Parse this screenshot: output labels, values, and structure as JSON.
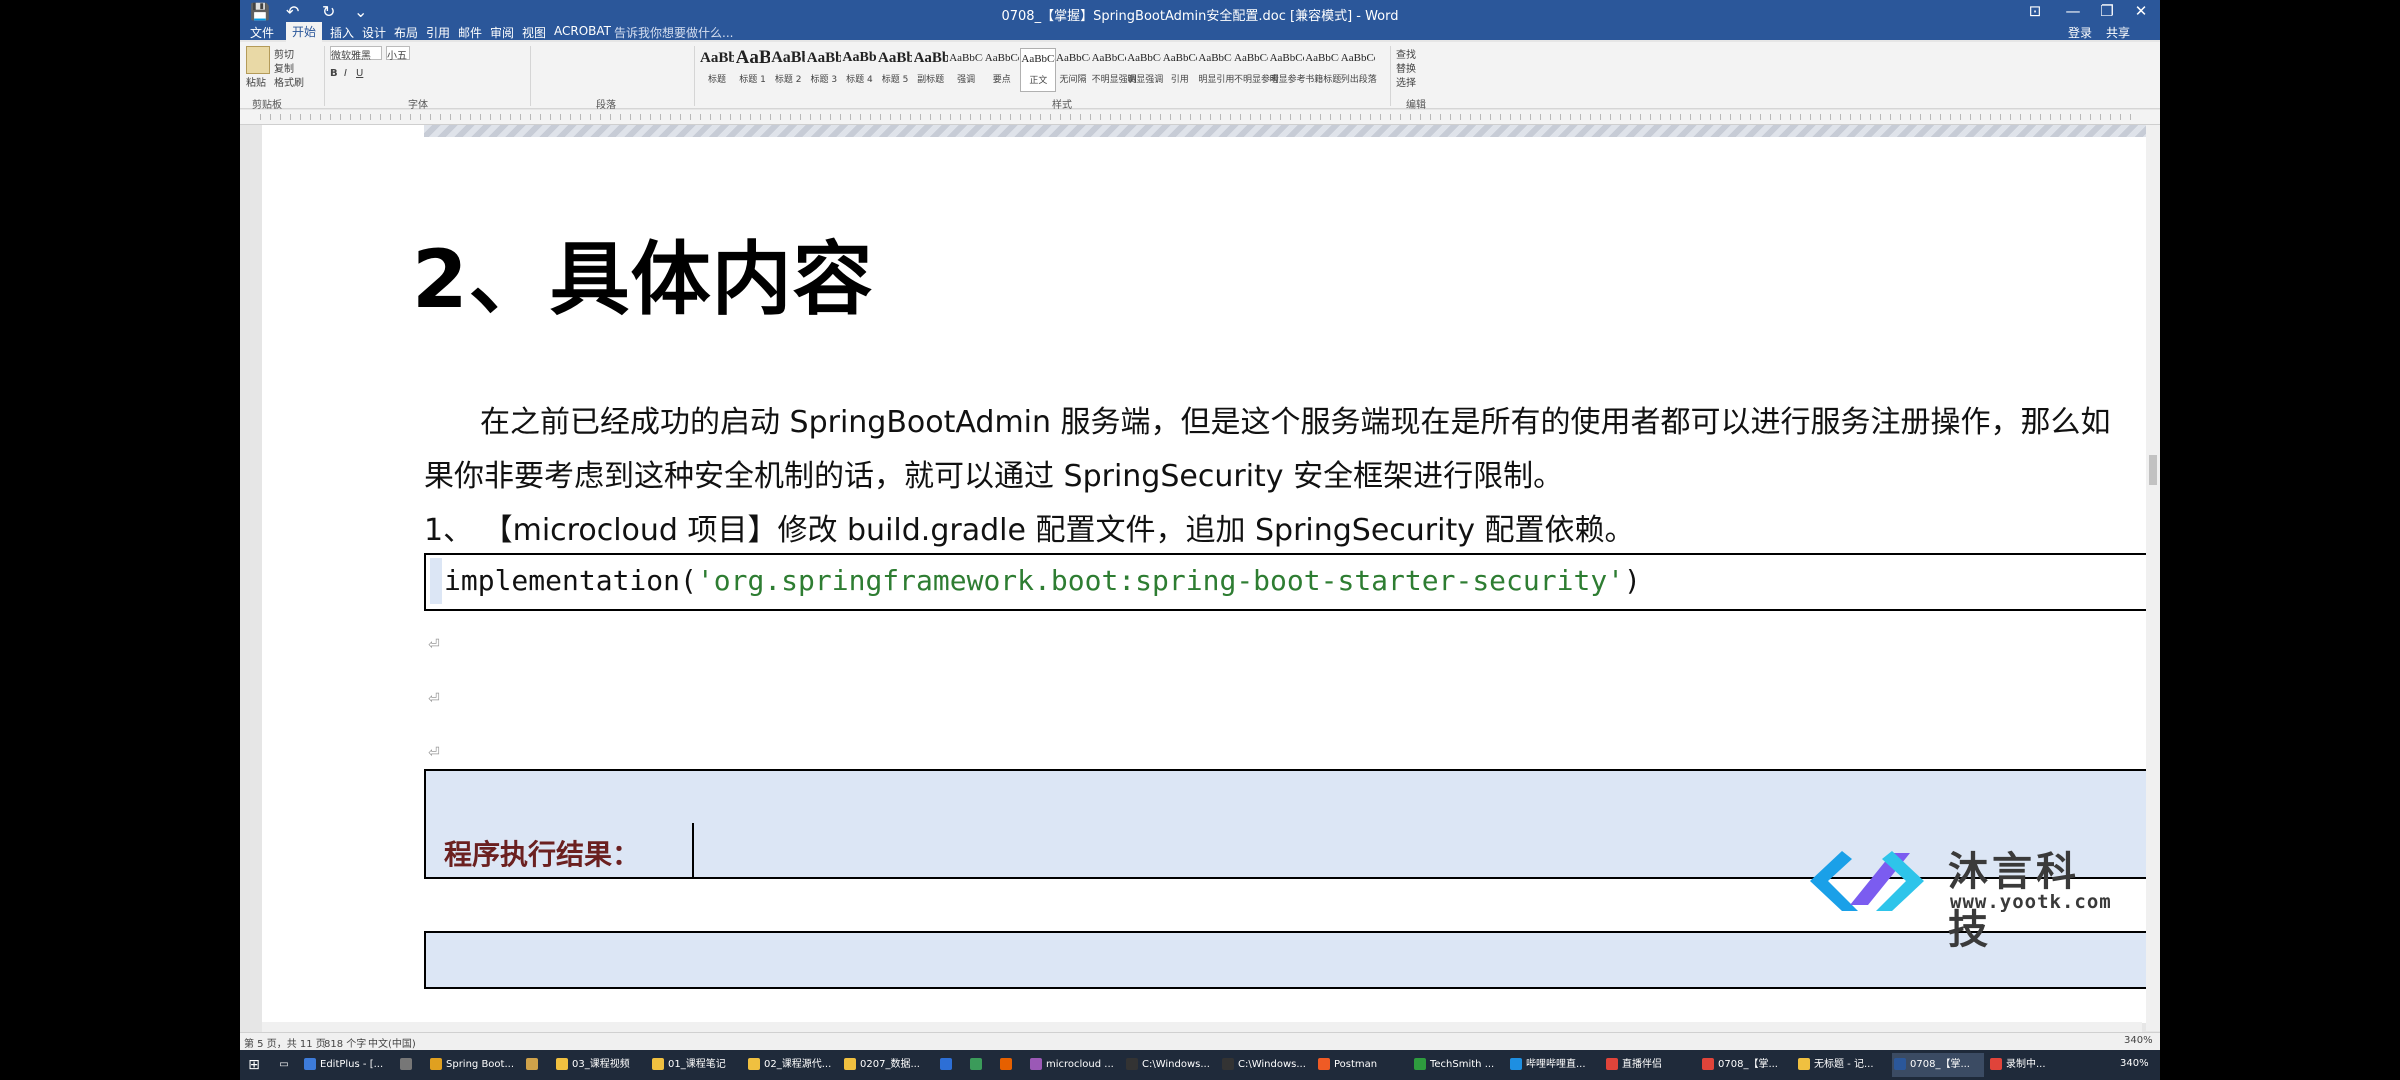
{
  "window": {
    "title": "0708_【掌握】SpringBootAdmin安全配置.doc [兼容模式] - Word",
    "controls": {
      "ribbon_display": "⊡",
      "minimize": "—",
      "restore": "❐",
      "close": "✕"
    },
    "account": {
      "login": "登录",
      "share": "共享"
    }
  },
  "quick_access": {
    "save": "💾",
    "undo": "↶",
    "redo": "↻",
    "customize": "⌄"
  },
  "tabs": [
    "文件",
    "开始",
    "插入",
    "设计",
    "布局",
    "引用",
    "邮件",
    "审阅",
    "视图",
    "ACROBAT"
  ],
  "active_tab": "开始",
  "tell_me": "告诉我你想要做什么...",
  "ribbon": {
    "clipboard": {
      "paste": "粘贴",
      "cut": "剪切",
      "copy": "复制",
      "format_painter": "格式刷",
      "label": "剪贴板"
    },
    "font": {
      "name": "微软雅黑",
      "size": "小五",
      "label": "字体",
      "bold": "B",
      "italic": "I",
      "underline": "U"
    },
    "paragraph": {
      "label": "段落"
    },
    "styles": {
      "label": "样式",
      "items": [
        {
          "sample": "AaBbC",
          "name": "标题"
        },
        {
          "sample": "AaBl",
          "name": "标题 1"
        },
        {
          "sample": "AaBb(",
          "name": "标题 2"
        },
        {
          "sample": "AaBb(",
          "name": "标题 3"
        },
        {
          "sample": "AaBbC(",
          "name": "标题 4"
        },
        {
          "sample": "AaBbC",
          "name": "标题 5"
        },
        {
          "sample": "AaBbC",
          "name": "副标题"
        },
        {
          "sample": "AaBbCcDt",
          "name": "强调"
        },
        {
          "sample": "AaBbCcD",
          "name": "要点"
        },
        {
          "sample": "AaBbCcDc",
          "name": "正文"
        },
        {
          "sample": "AaBbCcDc",
          "name": "无间隔"
        },
        {
          "sample": "AaBbCcDc",
          "name": "不明显强调"
        },
        {
          "sample": "AaBbCcDc",
          "name": "明显强调"
        },
        {
          "sample": "AaBbCcDc",
          "name": "引用"
        },
        {
          "sample": "AaBbCcDc",
          "name": "明显引用"
        },
        {
          "sample": "AaBbCcD",
          "name": "不明显参考"
        },
        {
          "sample": "AaBbCcI",
          "name": "明显参考"
        },
        {
          "sample": "AaBbCcD",
          "name": "书籍标题"
        },
        {
          "sample": "AaBbCcDc",
          "name": "列出段落"
        }
      ],
      "selected": "正文"
    },
    "editing": {
      "label": "编辑",
      "find": "查找",
      "replace": "替换",
      "select": "选择"
    }
  },
  "document": {
    "heading": "2、具体内容",
    "para1_line1": "在之前已经成功的启动 SpringBootAdmin 服务端，但是这个服务端现在是所有的使用者都可以进行服务注册操作，那么如",
    "para1_line2": "果你非要考虑到这种安全机制的话，就可以通过 SpringSecurity 安全框架进行限制。",
    "step1": "1、 【microcloud 项目】修改 build.gradle 配置文件，追加 SpringSecurity 配置依赖。",
    "code_prefix": "implementation(",
    "code_string": "'org.springframework.boot:spring-boot-starter-security'",
    "code_suffix": ")",
    "result_label": "程序执行结果："
  },
  "watermark": {
    "name": "沐言科技",
    "url": "www.yootk.com"
  },
  "statusbar": {
    "page": "第 5 页，共 11 页",
    "words": "818 个字",
    "language": "中文(中国)",
    "zoom": "340%"
  },
  "taskbar": {
    "items": [
      {
        "label": "EditPlus - [...",
        "color": "#3d7bd9"
      },
      {
        "label": "",
        "color": "#777777"
      },
      {
        "label": "Spring Boot...",
        "color": "#e0a020"
      },
      {
        "label": "",
        "color": "#cfa24a"
      },
      {
        "label": "03_课程视频",
        "color": "#f0c040"
      },
      {
        "label": "01_课程笔记",
        "color": "#f0c040"
      },
      {
        "label": "02_课程源代...",
        "color": "#f0c040"
      },
      {
        "label": "0207_数据...",
        "color": "#f0c040"
      },
      {
        "label": "",
        "color": "#2d6fd6"
      },
      {
        "label": "",
        "color": "#3b9b5a"
      },
      {
        "label": "",
        "color": "#e66000"
      },
      {
        "label": "microcloud ...",
        "color": "#9b59b6"
      },
      {
        "label": "C:\\Windows...",
        "color": "#333333"
      },
      {
        "label": "C:\\Windows...",
        "color": "#333333"
      },
      {
        "label": "Postman",
        "color": "#ef5b25"
      },
      {
        "label": "TechSmith ...",
        "color": "#2e9b3e"
      },
      {
        "label": "哔哩哔哩直...",
        "color": "#1e8fe1"
      },
      {
        "label": "直播伴侣",
        "color": "#e0443a"
      },
      {
        "label": "0708_【掌...",
        "color": "#e0443a"
      },
      {
        "label": "无标题 - 记...",
        "color": "#f0c040"
      },
      {
        "label": "0708_【掌...",
        "color": "#2b579a"
      },
      {
        "label": "录制中...",
        "color": "#e0443a"
      }
    ]
  },
  "colors": {
    "word_blue": "#2b579a",
    "code_string": "#2e7d32",
    "result_label": "#6b2020",
    "table_fill": "#dce6f5"
  }
}
